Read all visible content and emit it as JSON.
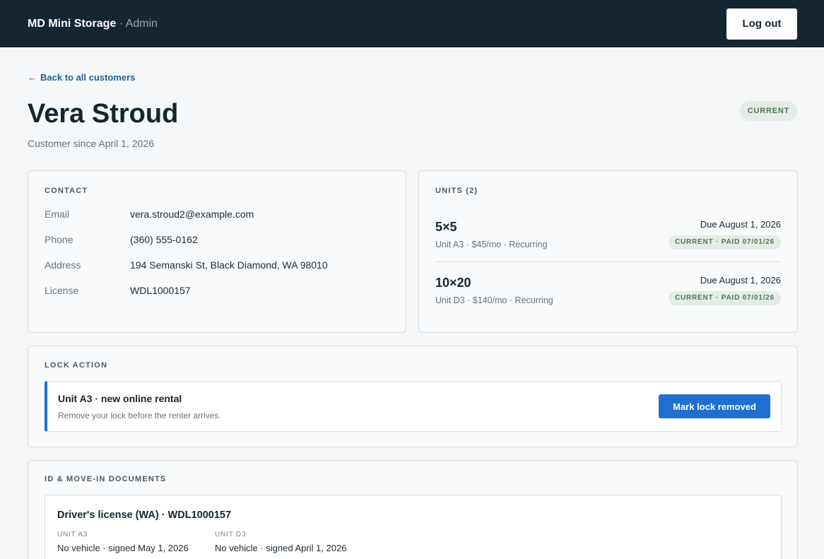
{
  "header": {
    "brand": "MD Mini Storage",
    "brand_suffix": " · Admin",
    "logout_label": "Log out"
  },
  "nav": {
    "back_arrow": "←",
    "back_label": "Back to all customers"
  },
  "customer": {
    "name": "Vera Stroud",
    "since": "Customer since April 1, 2026",
    "status": "CURRENT"
  },
  "contact": {
    "title": "CONTACT",
    "rows": [
      {
        "label": "Email",
        "value": "vera.stroud2@example.com"
      },
      {
        "label": "Phone",
        "value": "(360) 555-0162"
      },
      {
        "label": "Address",
        "value": "194 Semanski St, Black Diamond, WA 98010"
      },
      {
        "label": "License",
        "value": "WDL1000157"
      }
    ]
  },
  "units": {
    "title": "UNITS (2)",
    "items": [
      {
        "size": "5×5",
        "meta": "Unit A3 · $45/mo · Recurring",
        "due": "Due August 1, 2026",
        "status": "CURRENT · PAID 07/01/26"
      },
      {
        "size": "10×20",
        "meta": "Unit D3 · $140/mo · Recurring",
        "due": "Due August 1, 2026",
        "status": "CURRENT · PAID 07/01/26"
      }
    ]
  },
  "lock_action": {
    "title": "LOCK ACTION",
    "heading": "Unit A3 · new online rental",
    "description": "Remove your lock before the renter arrives.",
    "button_label": "Mark lock removed"
  },
  "documents": {
    "title": "ID & MOVE-IN DOCUMENTS",
    "heading": "Driver's license (WA) · WDL1000157",
    "columns": [
      {
        "caption": "UNIT A3",
        "text": "No vehicle · signed May 1, 2026"
      },
      {
        "caption": "UNIT D3",
        "text": "No vehicle · signed April 1, 2026"
      }
    ]
  },
  "colors": {
    "topbar": "#14262f",
    "accent": "#1f6fd1",
    "status_badge_bg": "#e5ebe6",
    "status_badge_text": "#4c7a57"
  }
}
